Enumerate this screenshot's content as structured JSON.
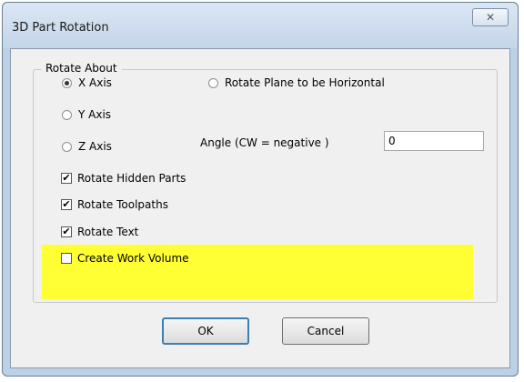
{
  "window": {
    "title": "3D Part Rotation",
    "close_glyph": "✕"
  },
  "group": {
    "legend": "Rotate About"
  },
  "radios": {
    "x_axis": {
      "label": "X Axis",
      "selected": true
    },
    "y_axis": {
      "label": "Y Axis",
      "selected": false
    },
    "z_axis": {
      "label": "Z Axis",
      "selected": false
    },
    "horizontal": {
      "label": "Rotate Plane to be Horizontal",
      "selected": false
    }
  },
  "angle": {
    "label": "Angle (CW = negative )",
    "value": "0"
  },
  "checkboxes": {
    "hidden_parts": {
      "label": "Rotate Hidden Parts",
      "checked": true
    },
    "toolpaths": {
      "label": "Rotate Toolpaths",
      "checked": true
    },
    "text": {
      "label": "Rotate Text",
      "checked": true
    },
    "work_volume": {
      "label": "Create Work Volume",
      "checked": false
    }
  },
  "buttons": {
    "ok": "OK",
    "cancel": "Cancel"
  },
  "colors": {
    "highlight": "#ffff33"
  }
}
